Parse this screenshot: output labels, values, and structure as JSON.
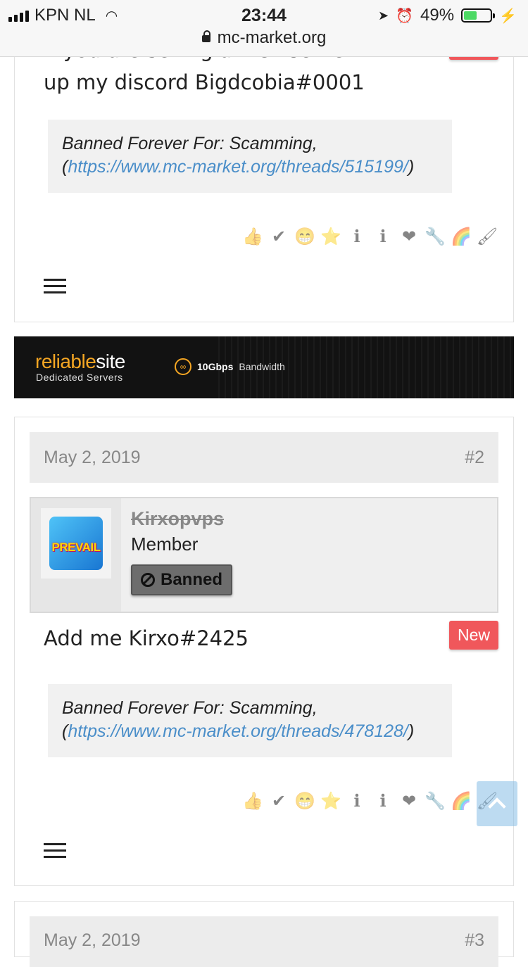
{
  "status_bar": {
    "carrier": "KPN NL",
    "time": "23:44",
    "battery": "49%",
    "battery_level": 0.49,
    "url": "mc-market.org"
  },
  "post1": {
    "message_cut": "If you are selling a MCF server hit",
    "message": "up my discord Bigdcobia#0001",
    "ban_text": "Banned Forever For: Scamming,",
    "ban_open": "(",
    "ban_link": "https://www.mc-market.org/threads/515199/",
    "ban_close": ")"
  },
  "ad": {
    "brand_a": "reliable",
    "brand_b": "site",
    "sub": "Dedicated Servers",
    "bandwidth_bold": "10Gbps",
    "bandwidth": "Bandwidth"
  },
  "post2": {
    "date": "May 2, 2019",
    "number": "#2",
    "username": "Kirxopvps",
    "role": "Member",
    "avatar_text": "PREVAIL",
    "banned_label": "Banned",
    "new_badge": "New",
    "message": "Add me Kirxo#2425",
    "ban_text": "Banned Forever For: Scamming,",
    "ban_open": "(",
    "ban_link": "https://www.mc-market.org/threads/478128/",
    "ban_close": ")"
  },
  "post3": {
    "date": "May 2, 2019",
    "number": "#3"
  },
  "reactions": [
    "👍",
    "✔",
    "😁",
    "⭐",
    "ℹ",
    "ℹ",
    "❤",
    "🔧",
    "🌈",
    "🖌"
  ],
  "colors": {
    "link": "#4a8ec9",
    "new_badge": "#f0575b",
    "accent_ad": "#f5a623"
  }
}
